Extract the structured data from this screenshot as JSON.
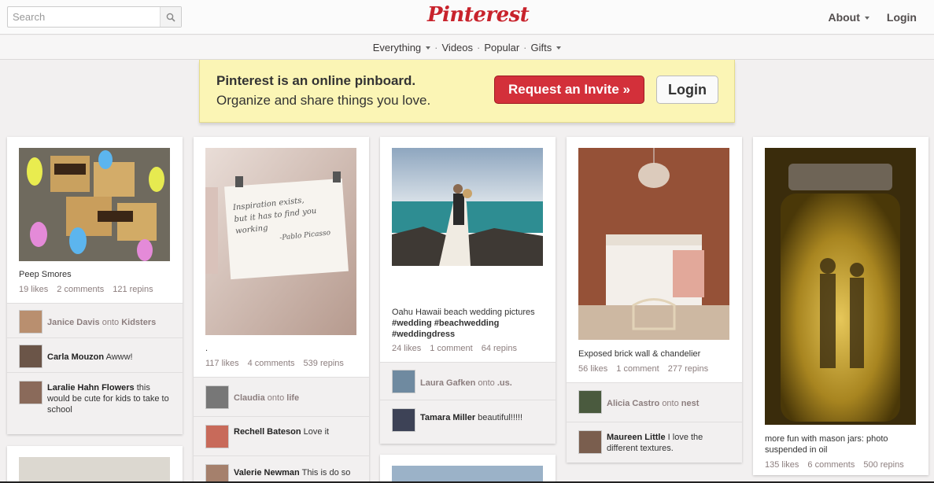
{
  "search": {
    "placeholder": "Search"
  },
  "logo": "Pinterest",
  "topnav": {
    "about": "About",
    "login": "Login"
  },
  "subnav": {
    "everything": "Everything",
    "videos": "Videos",
    "popular": "Popular",
    "gifts": "Gifts",
    "sep": "·"
  },
  "banner": {
    "title": "Pinterest is an online pinboard.",
    "subtitle": "Organize and share things you love.",
    "invite": "Request an Invite »",
    "login": "Login"
  },
  "pins": [
    {
      "desc": "Peep Smores",
      "likes": "19 likes",
      "comments": "2 comments",
      "repins": "121 repins",
      "activity": [
        {
          "name": "Janice Davis",
          "text": "onto",
          "board": "Kidsters"
        },
        {
          "name": "Carla Mouzon",
          "text": "Awww!"
        },
        {
          "name": "Laralie Hahn Flowers",
          "text": "this would be cute for kids to take to school"
        }
      ]
    },
    {
      "desc": ".",
      "likes": "117 likes",
      "comments": "4 comments",
      "repins": "539 repins",
      "note": [
        "Inspiration exists,",
        "but it has to find you",
        "working",
        "-Pablo Picasso"
      ],
      "activity": [
        {
          "name": "Claudia",
          "text": "onto",
          "board": "life"
        },
        {
          "name": "Rechell Bateson",
          "text": "Love it"
        },
        {
          "name": "Valerie Newman",
          "text": "This is do so"
        }
      ]
    },
    {
      "desc": "Oahu Hawaii beach wedding pictures",
      "tags": "#wedding #beachwedding #weddingdress",
      "likes": "24 likes",
      "comments": "1 comment",
      "repins": "64 repins",
      "activity": [
        {
          "name": "Laura Gafken",
          "text": "onto",
          "board": ".us."
        },
        {
          "name": "Tamara Miller",
          "text": "beautiful!!!!!"
        }
      ]
    },
    {
      "desc": "Exposed brick wall & chandelier",
      "likes": "56 likes",
      "comments": "1 comment",
      "repins": "277 repins",
      "activity": [
        {
          "name": "Alicia Castro",
          "text": "onto",
          "board": "nest"
        },
        {
          "name": "Maureen Little",
          "text": "I love the different textures."
        }
      ]
    },
    {
      "desc": "more fun with mason jars: photo suspended in oil",
      "likes": "135 likes",
      "comments": "6 comments",
      "repins": "500 repins"
    }
  ],
  "colors": {
    "brand": "#c8232c",
    "banner": "#fbf5b5",
    "invite": "#d3303a"
  }
}
